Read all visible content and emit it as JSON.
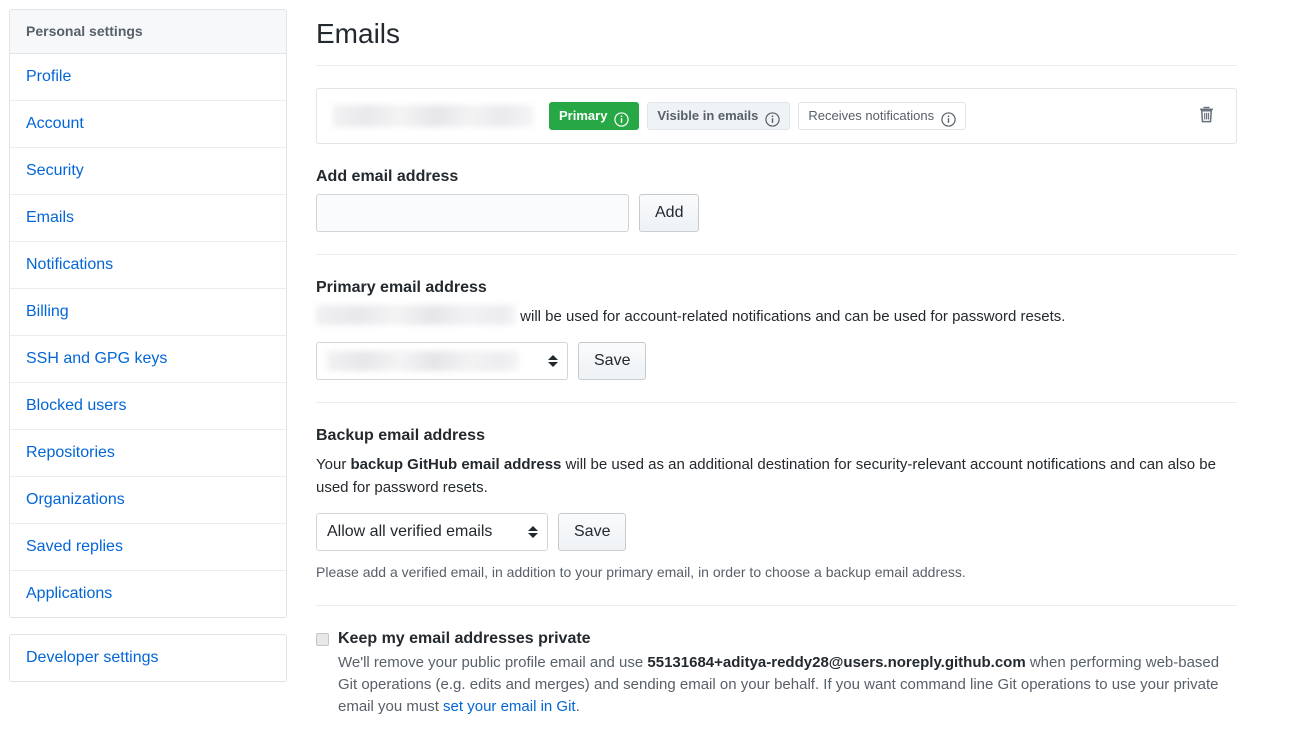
{
  "sidebar": {
    "header": "Personal settings",
    "items": [
      {
        "label": "Profile"
      },
      {
        "label": "Account"
      },
      {
        "label": "Security"
      },
      {
        "label": "Emails"
      },
      {
        "label": "Notifications"
      },
      {
        "label": "Billing"
      },
      {
        "label": "SSH and GPG keys"
      },
      {
        "label": "Blocked users"
      },
      {
        "label": "Repositories"
      },
      {
        "label": "Organizations"
      },
      {
        "label": "Saved replies"
      },
      {
        "label": "Applications"
      }
    ],
    "developer": {
      "label": "Developer settings"
    }
  },
  "main": {
    "title": "Emails",
    "email_row": {
      "address": "",
      "badges": [
        {
          "label": "Primary",
          "style": "primary",
          "info": "info-icon"
        },
        {
          "label": "Visible in emails",
          "style": "visible",
          "info": "info-icon"
        },
        {
          "label": "Receives notifications",
          "style": "notify",
          "info": "info-icon"
        }
      ],
      "delete_icon": "trash-icon"
    },
    "add_email": {
      "title": "Add email address",
      "input_value": "",
      "input_placeholder": "",
      "button_label": "Add"
    },
    "primary_email": {
      "title": "Primary email address",
      "note_suffix": " will be used for account-related notifications and can be used for password resets.",
      "select_value": "",
      "button_label": "Save"
    },
    "backup_email": {
      "title": "Backup email address",
      "note_prefix": "Your ",
      "note_bold": "backup GitHub email address",
      "note_suffix": " will be used as an additional destination for security-relevant account notifications and can also be used for password resets.",
      "select_value": "Allow all verified emails",
      "select_options": [
        "Allow all verified emails"
      ],
      "button_label": "Save",
      "helper": "Please add a verified email, in addition to your primary email, in order to choose a backup email address."
    },
    "privacy": {
      "checked": false,
      "label": "Keep my email addresses private",
      "desc_part1": "We'll remove your public profile email and use ",
      "desc_email": "55131684+aditya-reddy28@users.noreply.github.com",
      "desc_part2": " when performing web-based Git operations (e.g. edits and merges) and sending email on your behalf. If you want command line Git operations to use your private email you must ",
      "desc_link": "set your email in Git",
      "desc_part3": "."
    }
  },
  "colors": {
    "accent": "#0366d6",
    "primary_badge": "#28a745",
    "text": "#24292e",
    "muted": "#586069",
    "border": "#e1e4e8"
  }
}
